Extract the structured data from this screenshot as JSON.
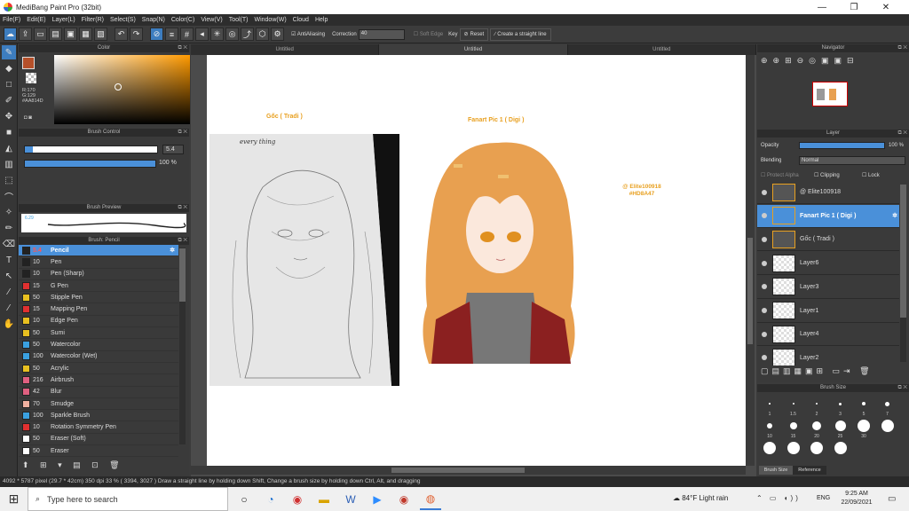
{
  "window": {
    "title": "MediBang Paint Pro (32bit)",
    "min": "—",
    "max": "❐",
    "close": "✕"
  },
  "menu": [
    "File(F)",
    "Edit(E)",
    "Layer(L)",
    "Filter(R)",
    "Select(S)",
    "Snap(N)",
    "Color(C)",
    "View(V)",
    "Tool(T)",
    "Window(W)",
    "Cloud",
    "Help"
  ],
  "toolbar": {
    "antialias_label": "AntiAliasing",
    "correction_label": "Correction",
    "correction_value": "40",
    "soft_edge_label": "Soft Edge",
    "key_label": "Key",
    "reset_label": "Reset",
    "straight_line_label": "Create a straight line"
  },
  "color_panel": {
    "title": "Color",
    "r": "R:170",
    "g": "G:129",
    "hex": "#AA814D",
    "main_color": "#b5502a",
    "picked_color": "#AA814D"
  },
  "brush_control": {
    "title": "Brush Control",
    "size_value": "5.4",
    "opacity_value": "100 %",
    "opacity_fraction": 1.0,
    "size_fraction": 0.06
  },
  "brush_preview": {
    "title": "Brush Preview",
    "size": "6.29"
  },
  "brush_list": {
    "title": "Brush: Pencil",
    "items": [
      {
        "size": "5.4",
        "name": "Pencil",
        "color": "#222222"
      },
      {
        "size": "10",
        "name": "Pen",
        "color": "#222222"
      },
      {
        "size": "10",
        "name": "Pen (Sharp)",
        "color": "#222222"
      },
      {
        "size": "15",
        "name": "G Pen",
        "color": "#e03030"
      },
      {
        "size": "50",
        "name": "Stipple Pen",
        "color": "#e8c020"
      },
      {
        "size": "15",
        "name": "Mapping Pen",
        "color": "#e03030"
      },
      {
        "size": "10",
        "name": "Edge Pen",
        "color": "#e8c020"
      },
      {
        "size": "50",
        "name": "Sumi",
        "color": "#e8c020"
      },
      {
        "size": "50",
        "name": "Watercolor",
        "color": "#3aa0e0"
      },
      {
        "size": "100",
        "name": "Watercolor (Wet)",
        "color": "#3aa0e0"
      },
      {
        "size": "50",
        "name": "Acrylic",
        "color": "#e8c020"
      },
      {
        "size": "216",
        "name": "Airbrush",
        "color": "#e06080"
      },
      {
        "size": "42",
        "name": "Blur",
        "color": "#e06080"
      },
      {
        "size": "70",
        "name": "Smudge",
        "color": "#f0b0a0"
      },
      {
        "size": "100",
        "name": "Sparkle Brush",
        "color": "#3aa0e0"
      },
      {
        "size": "10",
        "name": "Rotation Symmetry Pen",
        "color": "#e03030"
      },
      {
        "size": "50",
        "name": "Eraser (Soft)",
        "color": "#ffffff"
      },
      {
        "size": "50",
        "name": "Eraser",
        "color": "#ffffff"
      }
    ]
  },
  "tabs": [
    "Untitled",
    "Untitled",
    "Untitled"
  ],
  "canvas": {
    "label_left": "Gốc ( Tradi )",
    "label_right": "Fanart Pic 1 ( Digi )",
    "sketch_text": "every thing",
    "signature": "@ Elite100918",
    "signature_hex": "#HD8A47",
    "label_color": "#e8a020",
    "hair_color": "#e8a050",
    "jacket_color": "#8b2020"
  },
  "navigator": {
    "title": "Navigator"
  },
  "layer_panel": {
    "title": "Layer",
    "opacity_label": "Opacity",
    "opacity_value": "100 %",
    "blending_label": "Blending",
    "blending_value": "Normal",
    "protect_label": "Protect Alpha",
    "clipping_label": "Clipping",
    "lock_label": "Lock",
    "layers": [
      "@ Elite100918",
      "Fanart Pic 1 ( Digi )",
      "Gốc ( Tradi )",
      "Layer6",
      "Layer3",
      "Layer1",
      "Layer4",
      "Layer2"
    ]
  },
  "brush_size_panel": {
    "title": "Brush Size",
    "labels": [
      "1",
      "1.5",
      "2",
      "3",
      "5",
      "7",
      "10",
      "15",
      "20",
      "25",
      "30"
    ],
    "tab_brush": "Brush Size",
    "tab_reference": "Reference"
  },
  "status": "4092 * 5787 pixel   (29.7 * 42cm)   350 dpi   33 %   ( 3394, 3027 )   Draw a straight line by holding down Shift, Change a brush size by holding down Ctrl, Alt, and dragging",
  "taskbar": {
    "search_placeholder": "Type here to search",
    "weather": "84°F  Light rain",
    "lang": "ENG",
    "time": "9:25 AM",
    "date": "22/09/2021"
  }
}
